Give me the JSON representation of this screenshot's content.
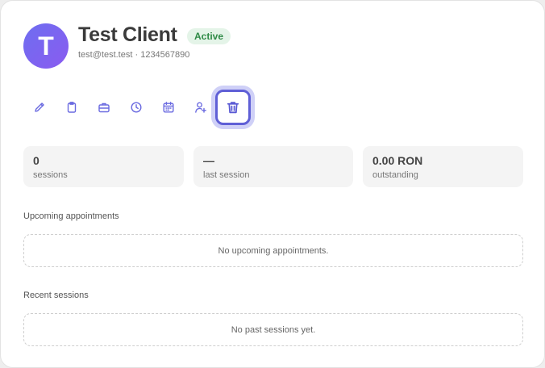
{
  "client": {
    "avatar_initial": "T",
    "name": "Test Client",
    "status": "Active",
    "email": "test@test.test",
    "separator": " · ",
    "phone": "1234567890"
  },
  "toolbar": {
    "items": [
      {
        "icon": "pencil-icon"
      },
      {
        "icon": "clipboard-icon"
      },
      {
        "icon": "briefcase-icon"
      },
      {
        "icon": "clock-icon"
      },
      {
        "icon": "calendar-icon"
      },
      {
        "icon": "user-plus-icon"
      },
      {
        "icon": "trash-icon",
        "active": true
      }
    ]
  },
  "stats": [
    {
      "value": "0",
      "label": "sessions"
    },
    {
      "value": "—",
      "label": "last session"
    },
    {
      "value": "0.00 RON",
      "label": "outstanding"
    }
  ],
  "upcoming": {
    "title": "Upcoming appointments",
    "empty_text": "No upcoming appointments."
  },
  "recent": {
    "title": "Recent sessions",
    "empty_text": "No past sessions yet."
  },
  "colors": {
    "accent": "#6a6ae0",
    "active_badge_bg": "#e4f4e8",
    "active_badge_text": "#2e8a46"
  }
}
